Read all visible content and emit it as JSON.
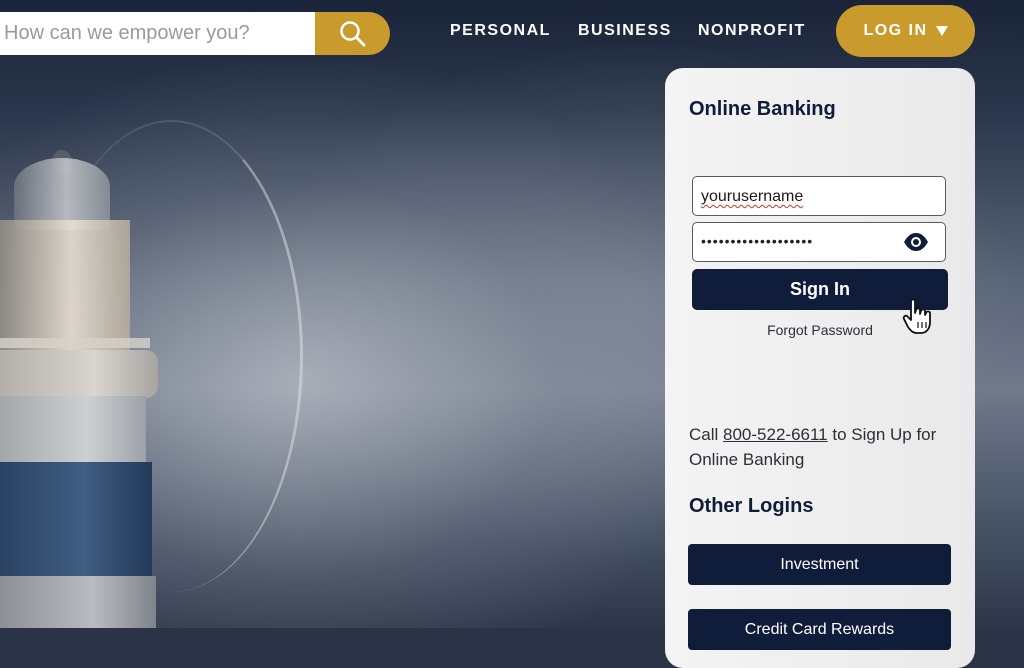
{
  "header": {
    "search": {
      "placeholder": "How can we empower you?",
      "icon": "search-icon"
    },
    "nav": [
      "PERSONAL",
      "BUSINESS",
      "NONPROFIT"
    ],
    "login_label": "LOG IN",
    "login_icon": "caret-down-icon"
  },
  "login_panel": {
    "title": "Online Banking",
    "username_value": "yourusername",
    "password_value": "•••••••••••••••••••",
    "show_password_icon": "eye-icon",
    "sign_in_label": "Sign In",
    "forgot_password": "Forgot Password",
    "signup_text_before": "Call ",
    "signup_phone": "800-522-6611",
    "signup_text_after": " to Sign Up for Online Banking",
    "other_logins_title": "Other Logins",
    "other_logins": [
      "Investment",
      "Credit Card Rewards"
    ]
  },
  "colors": {
    "gold": "#c99a2c",
    "navy": "#0f1d3a",
    "panel": "#efefef"
  }
}
